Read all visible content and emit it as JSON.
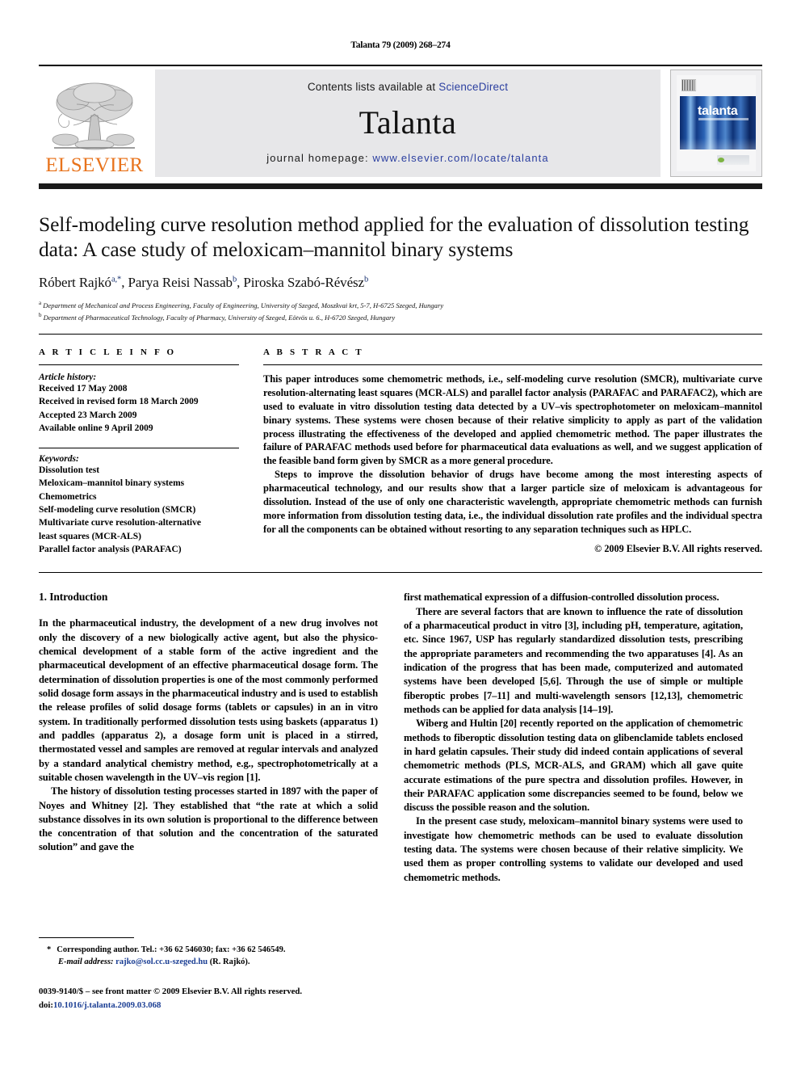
{
  "running_head": "Talanta 79 (2009) 268–274",
  "masthead": {
    "publisher_name": "ELSEVIER",
    "contents_prefix": "Contents lists available at ",
    "contents_link": "ScienceDirect",
    "journal_title": "Talanta",
    "homepage_prefix": "journal homepage: ",
    "homepage_url": "www.elsevier.com/locate/talanta",
    "cover_word": "talanta"
  },
  "title": "Self-modeling curve resolution method applied for the evaluation of dissolution testing data: A case study of meloxicam–mannitol binary systems",
  "authors": {
    "a1_name": "Róbert Rajkó",
    "a1_sup": "a,",
    "a1_star": "*",
    "sep1": ", ",
    "a2_name": "Parya Reisi Nassab",
    "a2_sup": "b",
    "sep2": ", ",
    "a3_name": "Piroska Szabó-Révész",
    "a3_sup": "b"
  },
  "affiliations": [
    {
      "marker": "a",
      "text": "Department of Mechanical and Process Engineering, Faculty of Engineering, University of Szeged, Moszkvai krt, 5-7, H-6725 Szeged, Hungary"
    },
    {
      "marker": "b",
      "text": "Department of Pharmaceutical Technology, Faculty of Pharmacy, University of Szeged, Eötvös u. 6., H-6720 Szeged, Hungary"
    }
  ],
  "article_info": {
    "heading": "A R T I C L E    I N F O",
    "history_label": "Article history:",
    "history": [
      "Received 17 May 2008",
      "Received in revised form 18 March 2009",
      "Accepted 23 March 2009",
      "Available online 9 April 2009"
    ],
    "keywords_label": "Keywords:",
    "keywords": [
      "Dissolution test",
      "Meloxicam–mannitol binary systems",
      "Chemometrics",
      "Self-modeling curve resolution (SMCR)",
      "Multivariate curve resolution-alternative",
      "least squares (MCR-ALS)",
      "Parallel factor analysis (PARAFAC)"
    ]
  },
  "abstract": {
    "heading": "A B S T R A C T",
    "paragraph_1": "This paper introduces some chemometric methods, i.e., self-modeling curve resolution (SMCR), multivariate curve resolution-alternating least squares (MCR-ALS) and parallel factor analysis (PARAFAC and PARAFAC2), which are used to evaluate in vitro dissolution testing data detected by a UV–vis spectrophotometer on meloxicam–mannitol binary systems. These systems were chosen because of their relative simplicity to apply as part of the validation process illustrating the effectiveness of the developed and applied chemometric method. The paper illustrates the failure of PARAFAC methods used before for pharmaceutical data evaluations as well, and we suggest application of the feasible band form given by SMCR as a more general procedure.",
    "paragraph_2": "Steps to improve the dissolution behavior of drugs have become among the most interesting aspects of pharmaceutical technology, and our results show that a larger particle size of meloxicam is advantageous for dissolution. Instead of the use of only one characteristic wavelength, appropriate chemometric methods can furnish more information from dissolution testing data, i.e., the individual dissolution rate profiles and the individual spectra for all the components can be obtained without resorting to any separation techniques such as HPLC.",
    "copyright": "© 2009 Elsevier B.V. All rights reserved."
  },
  "body": {
    "section_title": "1.  Introduction",
    "left_paragraphs": [
      "In the pharmaceutical industry, the development of a new drug involves not only the discovery of a new biologically active agent, but also the physico-chemical development of a stable form of the active ingredient and the pharmaceutical development of an effective pharmaceutical dosage form. The determination of dissolution properties is one of the most commonly performed solid dosage form assays in the pharmaceutical industry and is used to establish the release profiles of solid dosage forms (tablets or capsules) in an in vitro system. In traditionally performed dissolution tests using baskets (apparatus 1) and paddles (apparatus 2), a dosage form unit is placed in a stirred, thermostated vessel and samples are removed at regular intervals and analyzed by a standard analytical chemistry method, e.g., spectrophotometrically at a suitable chosen wavelength in the UV–vis region [1].",
      "The history of dissolution testing processes started in 1897 with the paper of Noyes and Whitney [2]. They established that “the rate at which a solid substance dissolves in its own solution is proportional to the difference between the concentration of that solution and the concentration of the saturated solution” and gave the"
    ],
    "right_paragraphs": [
      "first mathematical expression of a diffusion-controlled dissolution process.",
      "There are several factors that are known to influence the rate of dissolution of a pharmaceutical product in vitro [3], including pH, temperature, agitation, etc. Since 1967, USP has regularly standardized dissolution tests, prescribing the appropriate parameters and recommending the two apparatuses [4]. As an indication of the progress that has been made, computerized and automated systems have been developed [5,6]. Through the use of simple or multiple fiberoptic probes [7–11] and multi-wavelength sensors [12,13], chemometric methods can be applied for data analysis [14–19].",
      "Wiberg and Hultin [20] recently reported on the application of chemometric methods to fiberoptic dissolution testing data on glibenclamide tablets enclosed in hard gelatin capsules. Their study did indeed contain applications of several chemometric methods (PLS, MCR-ALS, and GRAM) which all gave quite accurate estimations of the pure spectra and dissolution profiles. However, in their PARAFAC application some discrepancies seemed to be found, below we discuss the possible reason and the solution.",
      "In the present case study, meloxicam–mannitol binary systems were used to investigate how chemometric methods can be used to evaluate dissolution testing data. The systems were chosen because of their relative simplicity. We used them as proper controlling systems to validate our developed and used chemometric methods."
    ]
  },
  "footnote": {
    "star": "*",
    "corresponding": "Corresponding author. Tel.: +36 62 546030; fax: +36 62 546549.",
    "email_label": "E-mail address:",
    "email": "rajko@sol.cc.u-szeged.hu",
    "email_suffix": "(R. Rajkó).",
    "issn_line": "0039-9140/$ – see front matter © 2009 Elsevier B.V. All rights reserved.",
    "doi_label": "doi:",
    "doi_value": "10.1016/j.talanta.2009.03.068"
  },
  "colors": {
    "link_blue": "#2b3fa0",
    "ref_blue": "#1c3f94",
    "elsevier_orange": "#E8731C",
    "band_gray": "#e7e7e9"
  }
}
